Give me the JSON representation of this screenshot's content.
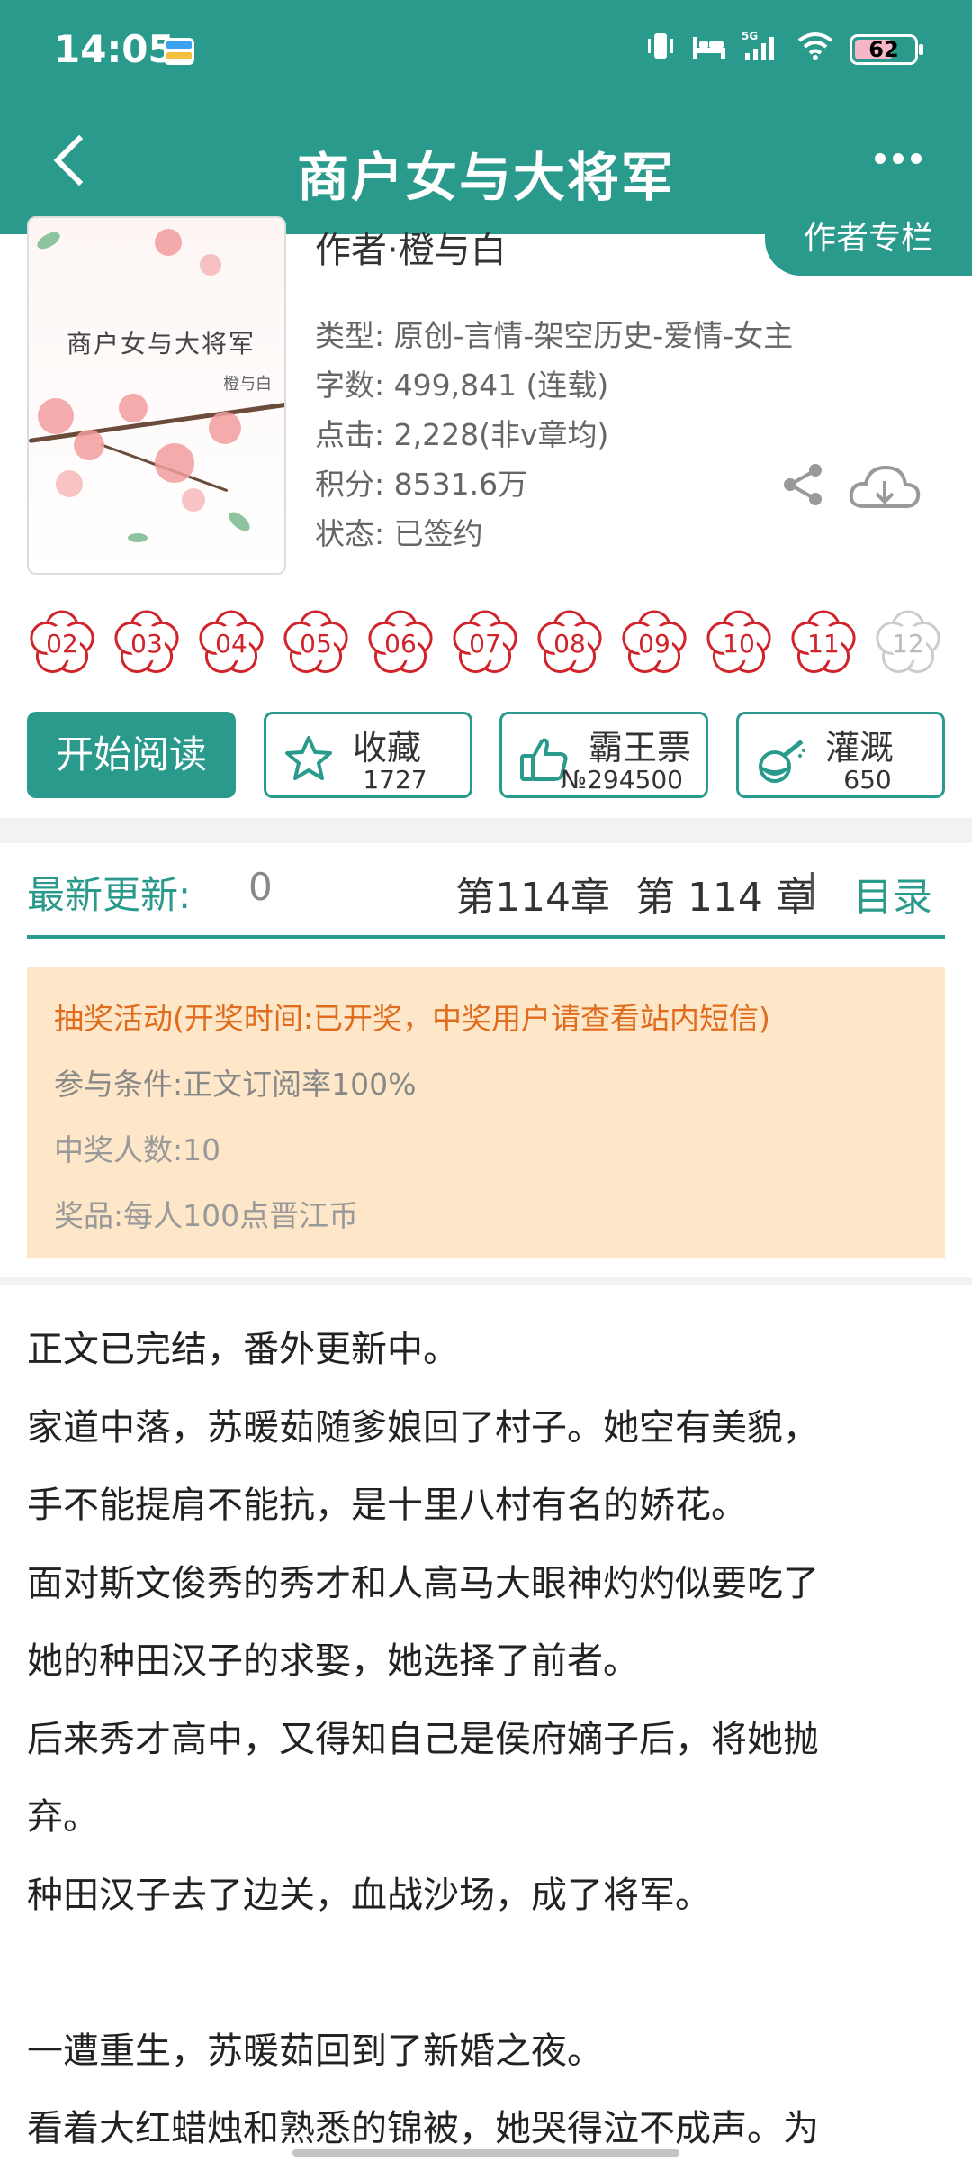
{
  "status_bar": {
    "time": "14:05",
    "network": "5G",
    "battery": "62",
    "battery_level": 0.62
  },
  "header": {
    "title": "商户女与大将军",
    "back_icon": "chevron-left-icon",
    "more_icon": "more-horizontal-icon"
  },
  "book": {
    "cover_title": "商户女与大将军",
    "cover_author": "橙与白",
    "author_line": "作者·橙与白",
    "author_column": "作者专栏",
    "type": "类型: 原创-言情-架空历史-爱情-女主",
    "words": "字数: 499,841 (连载)",
    "clicks": "点击: 2,228(非v章均)",
    "score": "积分: 8531.6万",
    "status": "状态: 已签约"
  },
  "flowers": [
    "02",
    "03",
    "04",
    "05",
    "06",
    "07",
    "08",
    "09",
    "10",
    "11",
    "12"
  ],
  "actions": {
    "start_reading": "开始阅读",
    "favorite": {
      "label": "收藏",
      "count": "1727"
    },
    "bawang": {
      "label": "霸王票",
      "count": "№294500"
    },
    "irrigate": {
      "label": "灌溉",
      "count": "650"
    }
  },
  "update": {
    "label": "最新更新:",
    "count": "0",
    "chapter": "第114章  第 114 章",
    "separator": "|",
    "toc": "目录"
  },
  "lottery": {
    "headline": "抽奖活动(开奖时间:已开奖，中奖用户请查看站内短信)",
    "condition": "参与条件:正文订阅率100%",
    "winners": "中奖人数:10",
    "prize": "奖品:每人100点晋江币"
  },
  "synopsis": [
    "正文已完结，番外更新中。",
    "家道中落，苏暖茹随爹娘回了村子。她空有美貌，",
    "手不能提肩不能抗，是十里八村有名的娇花。",
    "面对斯文俊秀的秀才和人高马大眼神灼灼似要吃了",
    "她的种田汉子的求娶，她选择了前者。",
    "后来秀才高中，又得知自己是侯府嫡子后，将她抛",
    "弃。",
    "种田汉子去了边关，血战沙场，成了将军。",
    "",
    "一遭重生，苏暖茹回到了新婚之夜。",
    "看着大红蜡烛和熟悉的锦被，她哭得泣不成声。为"
  ],
  "colors": {
    "accent": "#2a9a8d",
    "flower_red": "#d0232a",
    "lottery_bg": "#fde7c8",
    "lottery_head": "#e06b1c"
  }
}
